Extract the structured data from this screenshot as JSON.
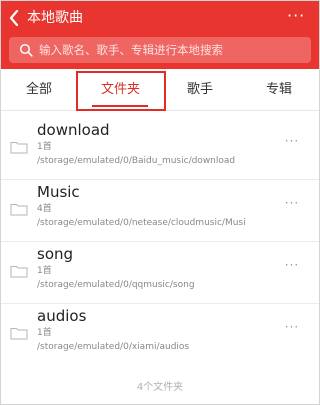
{
  "header": {
    "title": "本地歌曲",
    "more_label": "···",
    "background": "#e8352f"
  },
  "search": {
    "placeholder": "输入歌名、歌手、专辑进行本地搜索",
    "icon": "search-icon"
  },
  "tabs": [
    {
      "label": "全部",
      "active": false
    },
    {
      "label": "文件夹",
      "active": true
    },
    {
      "label": "歌手",
      "active": false
    },
    {
      "label": "专辑",
      "active": false
    }
  ],
  "folders": [
    {
      "name": "download",
      "count": "1首",
      "path": "/storage/emulated/0/Baidu_music/download",
      "more": "···"
    },
    {
      "name": "Music",
      "count": "4首",
      "path": "/storage/emulated/0/netease/cloudmusic/Musi",
      "more": "···"
    },
    {
      "name": "song",
      "count": "1首",
      "path": "/storage/emulated/0/qqmusic/song",
      "more": "···"
    },
    {
      "name": "audios",
      "count": "1首",
      "path": "/storage/emulated/0/xiami/audios",
      "more": "···"
    }
  ],
  "footer": "4个文件夹",
  "accent": "#e02b26"
}
